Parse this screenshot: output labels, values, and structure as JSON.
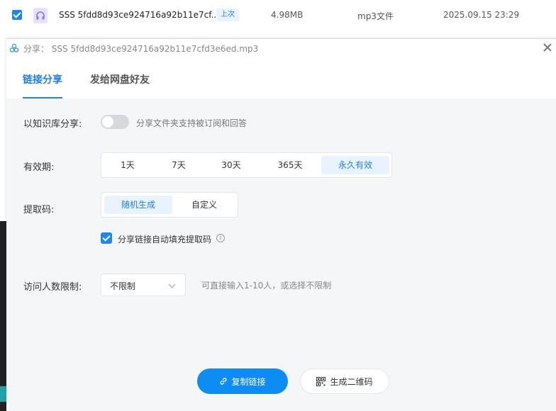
{
  "file_row": {
    "name": "SSS 5fdd8d93ce924716a92b11e7cf...",
    "badge": "上次",
    "size": "4.98MB",
    "type": "mp3文件",
    "modified": "2025.09.15 23:29"
  },
  "dialog": {
    "title": "分享：  SSS 5fdd8d93ce924716a92b11e7cfd3e6ed.mp3",
    "tabs": [
      {
        "label": "链接分享",
        "active": true
      },
      {
        "label": "发给网盘好友",
        "active": false
      }
    ],
    "knowledge_base": {
      "label": "以知识库分享:",
      "enabled": false,
      "hint": "分享文件夹支持被订阅和回答"
    },
    "validity": {
      "label": "有效期:",
      "options": [
        "1天",
        "7天",
        "30天",
        "365天",
        "永久有效"
      ],
      "selected": "永久有效"
    },
    "extract_code": {
      "label": "提取码:",
      "options": [
        "随机生成",
        "自定义"
      ],
      "selected": "随机生成",
      "autofill_label": "分享链接自动填充提取码",
      "autofill_checked": true
    },
    "visitor_limit": {
      "label": "访问人数限制:",
      "value": "不限制",
      "hint": "可直接输入1-10人，或选择不限制"
    },
    "buttons": {
      "copy_link": "复制链接",
      "qr_code": "生成二维码"
    }
  },
  "colors": {
    "accent": "#1f86f0",
    "primary_button": "#0d8cf4",
    "selected_bg": "#e9f3fe",
    "panel_bg": "#f5f6f8"
  },
  "icons": [
    "check-icon",
    "audio-file-icon",
    "share-app-icon",
    "close-icon",
    "chevron-down-icon",
    "info-icon",
    "link-icon",
    "qr-code-icon"
  ]
}
